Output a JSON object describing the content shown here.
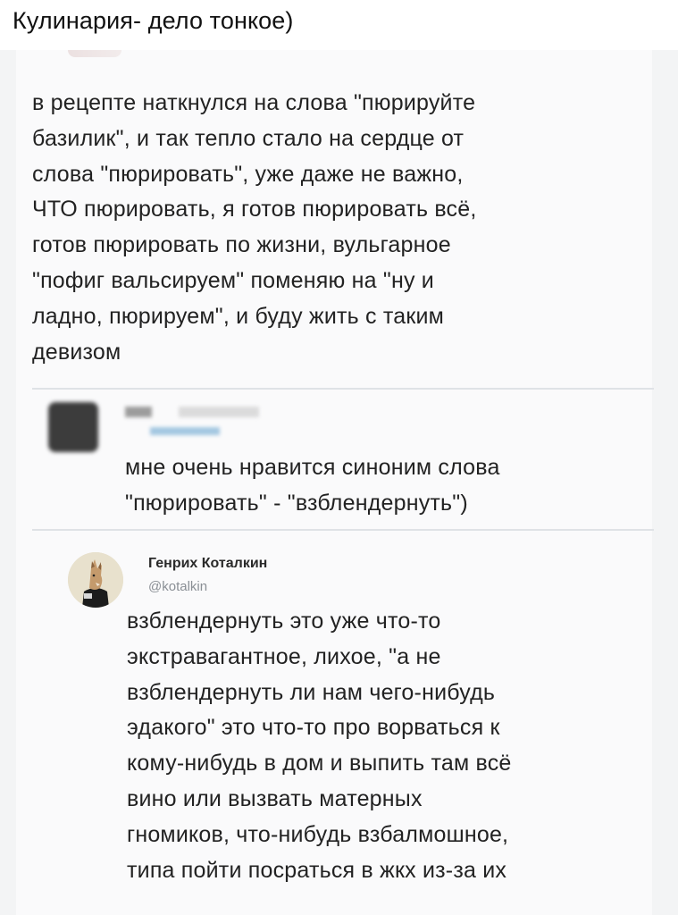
{
  "caption": "Кулинария- дело тонкое)",
  "posts": [
    {
      "lines": [
        "в рецепте наткнулся на слова \"пюрируйте",
        "базилик\", и так тепло стало на сердце от",
        "слова \"пюрировать\", уже даже не важно,",
        "ЧТО пюрировать, я готов пюрировать всё,",
        "готов пюрировать по жизни, вульгарное",
        "\"пофиг вальсируем\" поменяю на \"ну и",
        "ладно, пюрируем\", и буду жить с таким",
        "девизом"
      ]
    },
    {
      "lines": [
        "мне очень нравится синоним слова",
        "\"пюрировать\" - \"взблендернуть\")"
      ]
    },
    {
      "author": "Генрих Коталкин",
      "handle": "@kotalkin",
      "lines": [
        "взблендернуть это уже что-то",
        "экстравагантное, лихое, \"а не",
        "взблендернуть ли нам чего-нибудь",
        "эдакого\" это что-то про ворваться к",
        "кому-нибудь в дом и выпить там всё",
        "вино или вызвать матерных",
        "гномиков, что-нибудь взбалмошное,",
        "типа пойти посраться в жкх из-за их"
      ]
    }
  ]
}
